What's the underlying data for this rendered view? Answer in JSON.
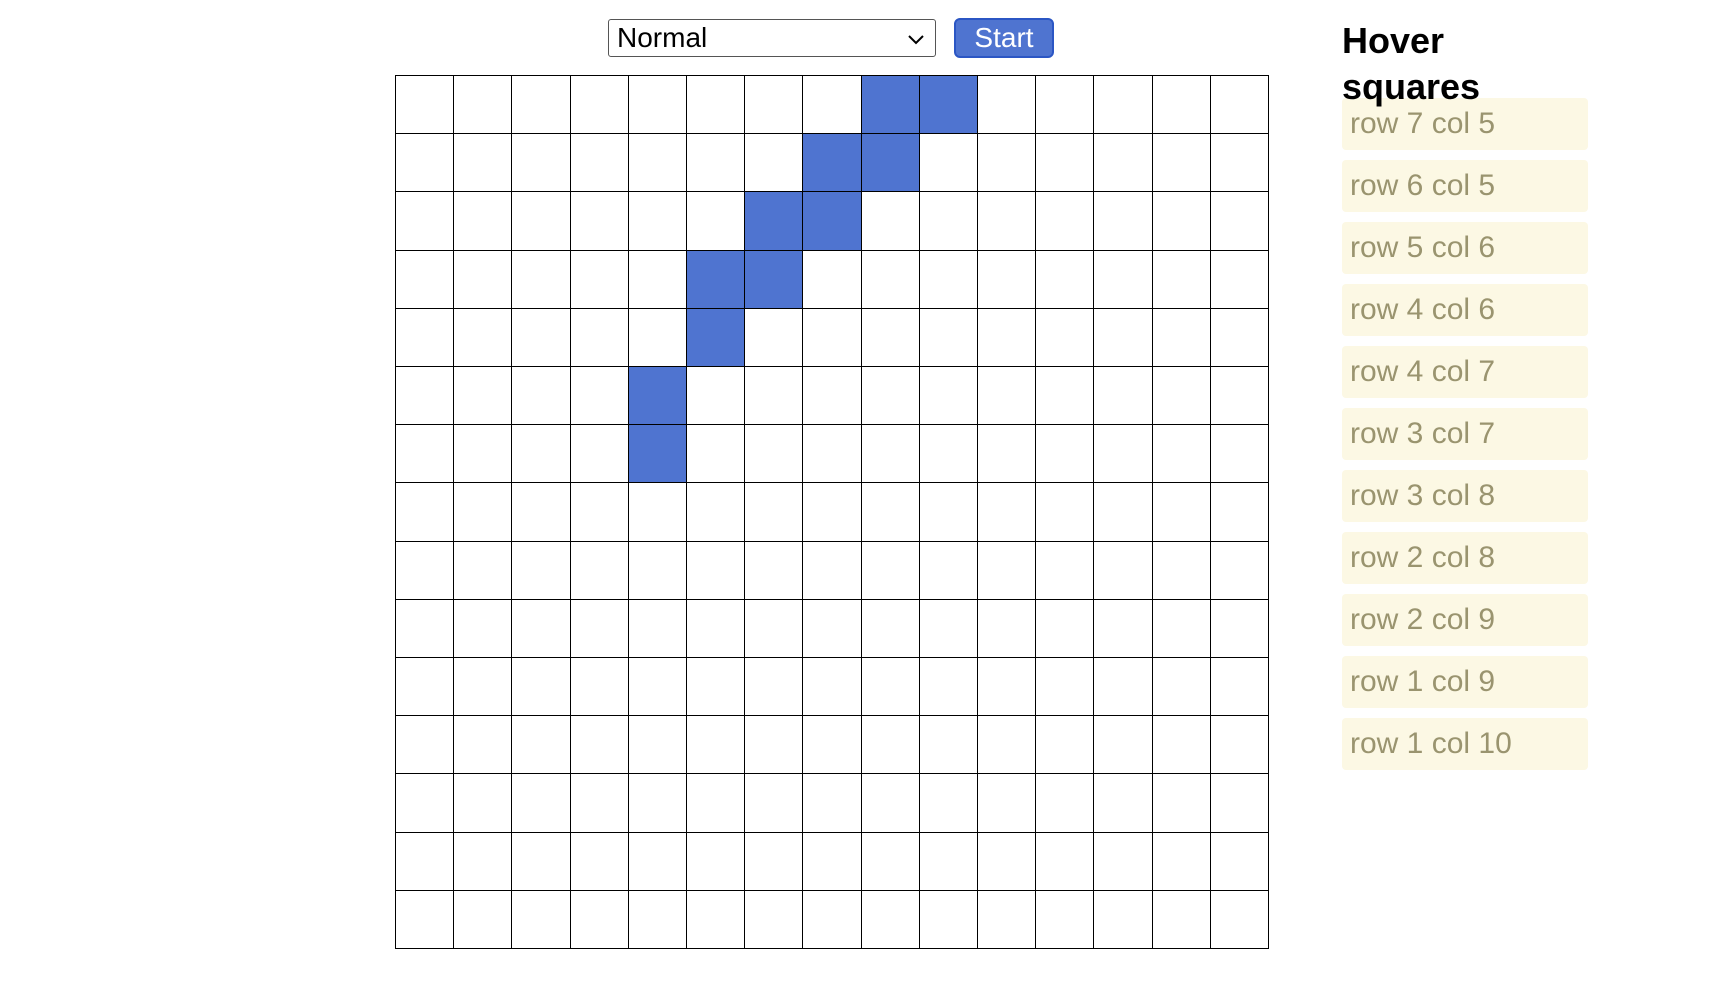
{
  "controls": {
    "mode_select_value": "Normal",
    "start_label": "Start",
    "accent_color": "#4f74d0"
  },
  "grid": {
    "rows": 15,
    "cols": 15,
    "highlighted_cells": [
      [
        1,
        9
      ],
      [
        1,
        10
      ],
      [
        2,
        8
      ],
      [
        2,
        9
      ],
      [
        3,
        7
      ],
      [
        3,
        8
      ],
      [
        4,
        6
      ],
      [
        4,
        7
      ],
      [
        5,
        6
      ],
      [
        6,
        5
      ],
      [
        7,
        5
      ]
    ]
  },
  "sidebar": {
    "title": "Hover squares",
    "items": [
      "row 7 col 5",
      "row 6 col 5",
      "row 5 col 6",
      "row 4 col 6",
      "row 4 col 7",
      "row 3 col 7",
      "row 3 col 8",
      "row 2 col 8",
      "row 2 col 9",
      "row 1 col 9",
      "row 1 col 10"
    ]
  }
}
